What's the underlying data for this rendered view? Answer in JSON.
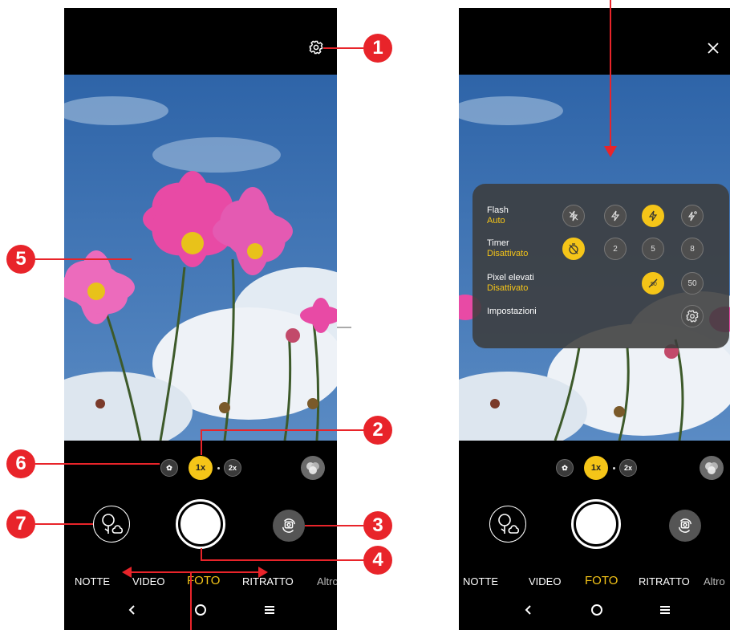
{
  "callouts": {
    "c1": "1",
    "c2": "2",
    "c3": "3",
    "c4": "4",
    "c5": "5",
    "c6": "6",
    "c7": "7"
  },
  "left_phone": {
    "zoom": {
      "macro": "",
      "active": "1x",
      "tele": "2x"
    },
    "modes": [
      "NOTTE",
      "VIDEO",
      "FOTO",
      "RITRATTO",
      "Altro"
    ],
    "active_mode": "FOTO"
  },
  "right_phone": {
    "zoom": {
      "macro": "",
      "active": "1x",
      "tele": "2x"
    },
    "modes": [
      "NOTTE",
      "VIDEO",
      "FOTO",
      "RITRATTO",
      "Altro"
    ],
    "active_mode": "FOTO",
    "settings_panel": {
      "flash": {
        "label": "Flash",
        "value": "Auto"
      },
      "timer": {
        "label": "Timer",
        "value": "Disattivato",
        "options": [
          "2",
          "5",
          "8"
        ]
      },
      "high_pixel": {
        "label": "Pixel elevati",
        "value": "Disattivato",
        "option_label": "50"
      },
      "settings": {
        "label": "Impostazioni"
      }
    }
  },
  "colors": {
    "accent": "#f5c518",
    "callout": "#e8242a",
    "sky": "#3d6ea8"
  },
  "icons": [
    "settings-gear-icon",
    "close-icon",
    "macro-flower-icon",
    "filter-icon",
    "gallery-icon",
    "flip-camera-icon",
    "back-icon",
    "home-icon",
    "menu-icon"
  ]
}
